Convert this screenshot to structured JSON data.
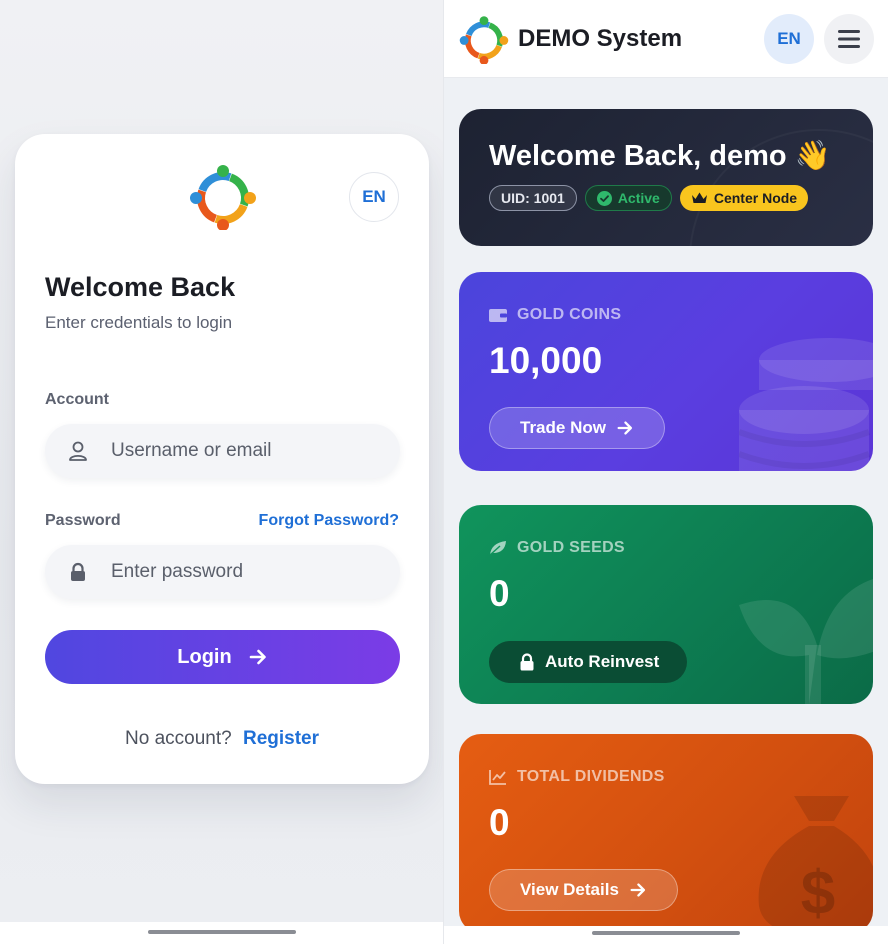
{
  "login": {
    "lang": "EN",
    "title": "Welcome Back",
    "subtitle": "Enter credentials to login",
    "account_label": "Account",
    "account_placeholder": "Username or email",
    "password_label": "Password",
    "forgot_label": "Forgot Password?",
    "password_placeholder": "Enter password",
    "login_label": "Login",
    "no_account_text": "No account?",
    "register_label": "Register"
  },
  "dashboard": {
    "app_title": "DEMO System",
    "lang": "EN",
    "welcome": {
      "title": "Welcome Back, demo 👋",
      "uid": "UID: 1001",
      "status": "Active",
      "node": "Center Node"
    },
    "coins": {
      "label": "GOLD COINS",
      "value": "10,000",
      "button": "Trade Now"
    },
    "seeds": {
      "label": "GOLD SEEDS",
      "value": "0",
      "button": "Auto Reinvest"
    },
    "dividends": {
      "label": "TOTAL DIVIDENDS",
      "value": "0",
      "button": "View Details"
    }
  },
  "colors": {
    "primary_gradient": [
      "#5047e0",
      "#7b3ce6"
    ],
    "link": "#1f6fd6",
    "coins_card": "#4b45dc",
    "seeds_card": "#10945c",
    "dividends_card": "#e55d12",
    "welcome_card": "#1d2232",
    "node_badge": "#f9c51e"
  }
}
